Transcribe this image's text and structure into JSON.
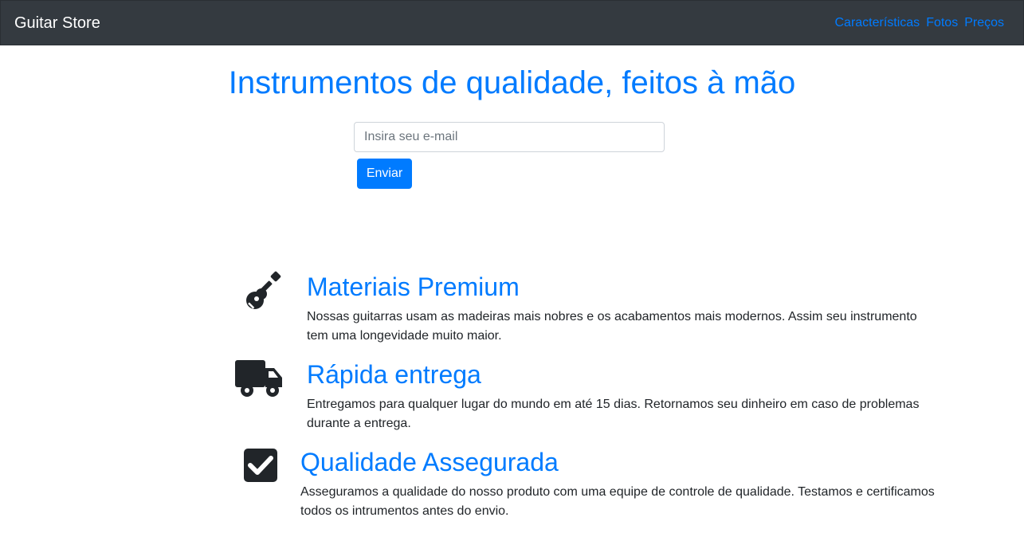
{
  "navbar": {
    "brand": "Guitar Store",
    "links": [
      "Características",
      "Fotos",
      "Preços"
    ]
  },
  "hero": {
    "title": "Instrumentos de qualidade, feitos à mão"
  },
  "signup": {
    "email_placeholder": "Insira seu e-mail",
    "submit_label": "Enviar"
  },
  "features": [
    {
      "icon": "guitar-icon",
      "title": "Materiais Premium",
      "text": "Nossas guitarras usam as madeiras mais nobres e os acabamentos mais modernos. Assim seu instrumento tem uma longevidade muito maior."
    },
    {
      "icon": "truck-icon",
      "title": "Rápida entrega",
      "text": "Entregamos para qualquer lugar do mundo em até 15 dias. Retornamos seu dinheiro em caso de problemas durante a entrega."
    },
    {
      "icon": "check-square-icon",
      "title": "Qualidade Assegurada",
      "text": "Asseguramos a qualidade do nosso produto com uma equipe de controle de qualidade. Testamos e certificamos todos os intrumentos antes do envio."
    }
  ],
  "colors": {
    "navbar_bg": "#343a40",
    "accent": "#007bff",
    "icon": "#212529"
  }
}
